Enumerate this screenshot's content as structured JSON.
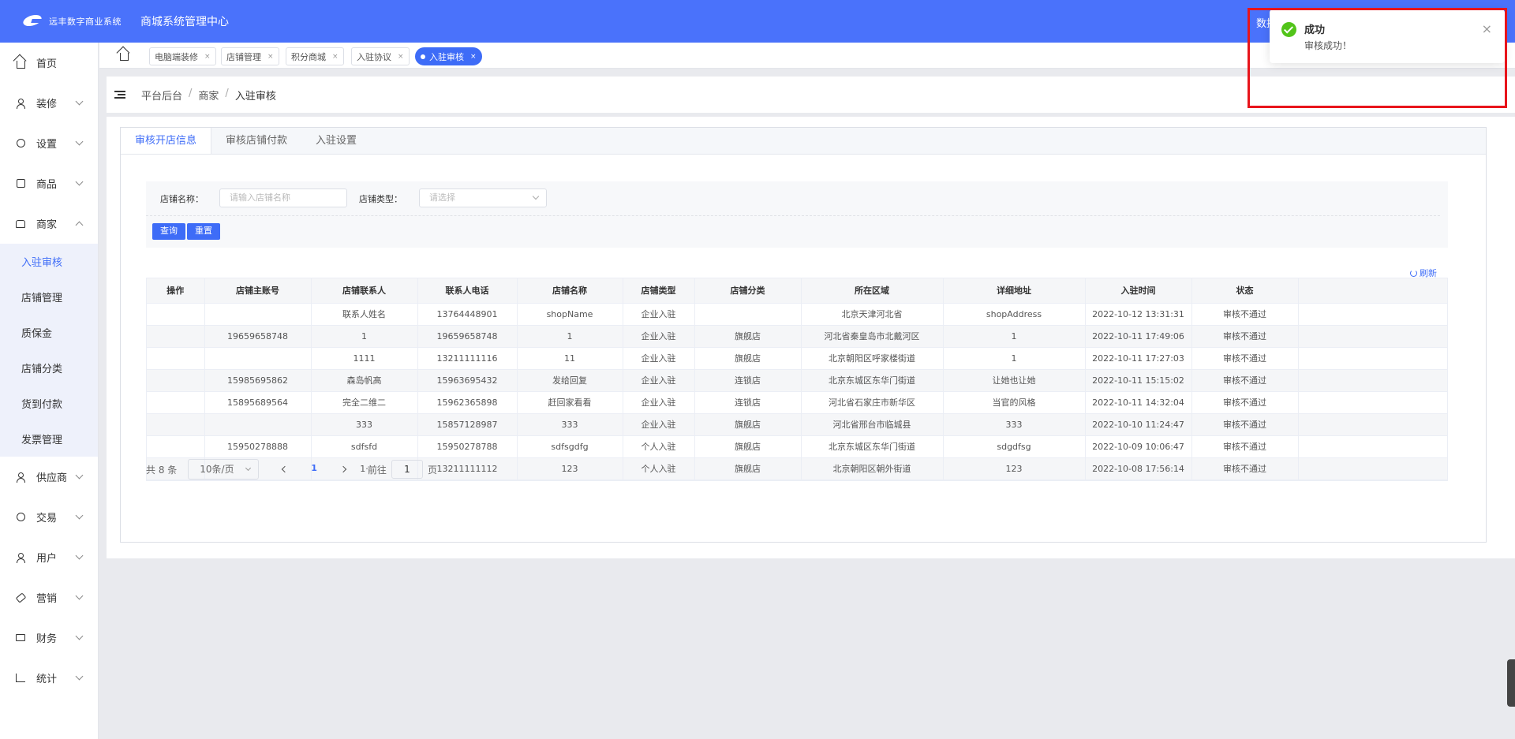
{
  "header": {
    "logo_text": "远丰数字商业系统",
    "system_title": "商城系统管理中心",
    "right_text": "数据"
  },
  "sidebar": {
    "items": [
      {
        "label": "首页",
        "icon": "home-icon"
      },
      {
        "label": "装修",
        "icon": "brush-icon"
      },
      {
        "label": "设置",
        "icon": "gear-icon"
      },
      {
        "label": "商品",
        "icon": "product-icon"
      },
      {
        "label": "商家",
        "icon": "store-icon"
      },
      {
        "label": "供应商",
        "icon": "supplier-icon"
      },
      {
        "label": "交易",
        "icon": "coin-icon"
      },
      {
        "label": "用户",
        "icon": "user-icon"
      },
      {
        "label": "营销",
        "icon": "tag-icon"
      },
      {
        "label": "财务",
        "icon": "wallet-icon"
      },
      {
        "label": "统计",
        "icon": "chart-icon"
      }
    ],
    "merchant_sub": [
      "入驻审核",
      "店铺管理",
      "质保金",
      "店铺分类",
      "货到付款",
      "发票管理"
    ]
  },
  "tags": {
    "items": [
      "电脑端装修",
      "店铺管理",
      "积分商城",
      "入驻协议",
      "入驻审核"
    ],
    "close": "×"
  },
  "breadcrumb": {
    "items": [
      "平台后台",
      "商家",
      "入驻审核"
    ],
    "separator": "/"
  },
  "tabs": [
    "审核开店信息",
    "审核店铺付款",
    "入驻设置"
  ],
  "filter": {
    "name_label": "店铺名称：",
    "name_placeholder": "请输入店铺名称",
    "type_label": "店铺类型：",
    "type_placeholder": "请选择",
    "query_button": "查询",
    "reset_button": "重置"
  },
  "refresh_label": "刷新",
  "table": {
    "columns": [
      "操作",
      "店铺主账号",
      "店铺联系人",
      "联系人电话",
      "店铺名称",
      "店铺类型",
      "店铺分类",
      "所在区域",
      "详细地址",
      "入驻时间",
      "状态"
    ],
    "rows": [
      [
        "",
        "",
        "联系人姓名",
        "13764448901",
        "shopName",
        "企业入驻",
        "",
        "北京天津河北省",
        "shopAddress",
        "2022-10-12 13:31:31",
        "审核不通过"
      ],
      [
        "",
        "19659658748",
        "1",
        "19659658748",
        "1",
        "企业入驻",
        "旗舰店",
        "河北省秦皇岛市北戴河区",
        "1",
        "2022-10-11 17:49:06",
        "审核不通过"
      ],
      [
        "",
        "",
        "1111",
        "13211111116",
        "11",
        "企业入驻",
        "旗舰店",
        "北京朝阳区呼家楼街道",
        "1",
        "2022-10-11 17:27:03",
        "审核不通过"
      ],
      [
        "",
        "15985695862",
        "森岛帆高",
        "15963695432",
        "发给回复",
        "企业入驻",
        "连锁店",
        "北京东城区东华门街道",
        "让她也让她",
        "2022-10-11 15:15:02",
        "审核不通过"
      ],
      [
        "",
        "15895689564",
        "完全二维二",
        "15962365898",
        "赶回家看看",
        "企业入驻",
        "连锁店",
        "河北省石家庄市新华区",
        "当官的风格",
        "2022-10-11 14:32:04",
        "审核不通过"
      ],
      [
        "",
        "",
        "333",
        "15857128987",
        "333",
        "企业入驻",
        "旗舰店",
        "河北省邢台市临城县",
        "333",
        "2022-10-10 11:24:47",
        "审核不通过"
      ],
      [
        "",
        "15950278888",
        "sdfsfd",
        "15950278788",
        "sdfsgdfg",
        "个人入驻",
        "旗舰店",
        "北京东城区东华门街道",
        "sdgdfsg",
        "2022-10-09 10:06:47",
        "审核不通过"
      ],
      [
        "",
        "",
        "1·",
        "13211111112",
        "123",
        "个人入驻",
        "旗舰店",
        "北京朝阳区朝外街道",
        "123",
        "2022-10-08 17:56:14",
        "审核不通过"
      ]
    ]
  },
  "pagination": {
    "total": "共 8 条",
    "page_size": "10条/页",
    "current_page": "1",
    "goto_label": "前往",
    "goto_value": "1",
    "page_suffix": "页"
  },
  "notification": {
    "title": "成功",
    "message": "审核成功！",
    "close": "×"
  },
  "colors": {
    "primary": "#3e6cf7",
    "header": "#4a72fb",
    "success": "#52c41a",
    "highlight": "#e8141b"
  }
}
